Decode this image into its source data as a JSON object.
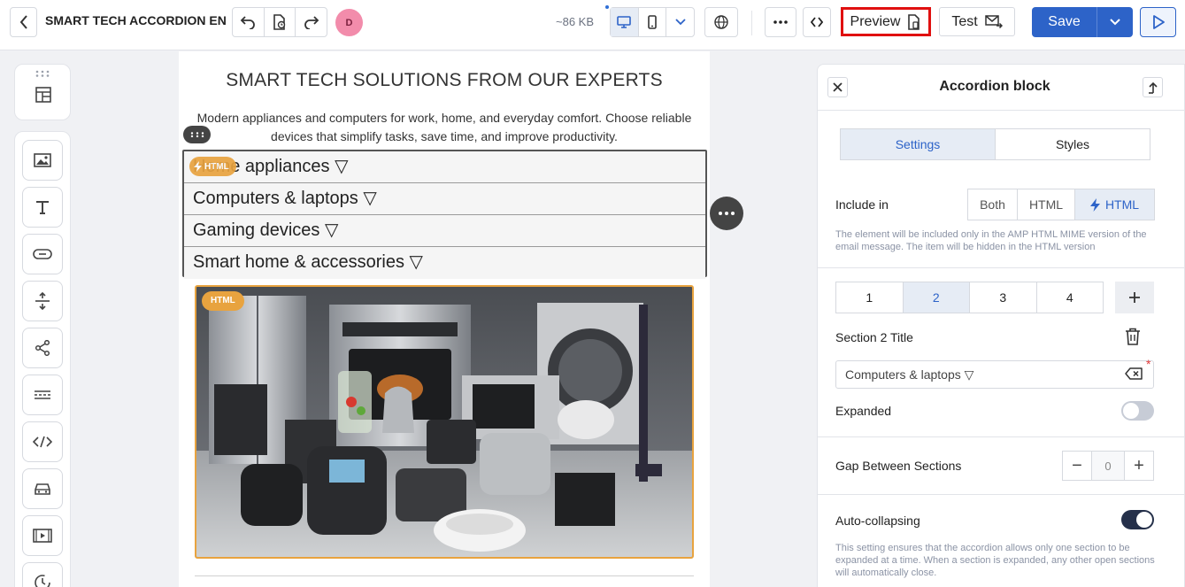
{
  "topbar": {
    "doc_title": "SMART TECH ACCORDION EN",
    "avatar_initial": "D",
    "size": "~86 KB",
    "preview_label": "Preview",
    "test_label": "Test",
    "save_label": "Save",
    "icons": [
      "back-icon",
      "undo-icon",
      "history-icon",
      "redo-icon",
      "desktop-icon",
      "mobile-icon",
      "chevron-down-icon",
      "globe-icon",
      "more-icon",
      "code-icon",
      "preview-device-icon",
      "mail-send-icon",
      "play-icon"
    ]
  },
  "left_toolbar": {
    "tools": [
      "structure",
      "image",
      "text",
      "button",
      "spacer",
      "social",
      "divider",
      "html",
      "menu",
      "video",
      "timer"
    ]
  },
  "canvas": {
    "title": "SMART TECH SOLUTIONS FROM OUR EXPERTS",
    "description": "Modern appliances and computers for work, home, and everyday comfort. Choose reliable devices that simplify tasks, save time, and improve productivity.",
    "amp_badge": "HTML",
    "accordion": [
      {
        "label": "Home appliances ▽"
      },
      {
        "label": "Computers & laptops ▽"
      },
      {
        "label": "Gaming devices ▽"
      },
      {
        "label": "Smart home & accessories ▽"
      }
    ],
    "image_badge": "HTML"
  },
  "panel": {
    "title": "Accordion block",
    "tabs": {
      "settings": "Settings",
      "styles": "Styles"
    },
    "include_in_label": "Include in",
    "include_options": {
      "both": "Both",
      "html": "HTML",
      "amp": "HTML"
    },
    "include_hint": "The element will be included only in the AMP HTML MIME version of the email message. The item will be hidden in the HTML version",
    "sections": [
      "1",
      "2",
      "3",
      "4"
    ],
    "active_section": "2",
    "section_title_label": "Section 2 Title",
    "section_title_value": "Computers & laptops ▽",
    "required_mark": "*",
    "expanded_label": "Expanded",
    "expanded": false,
    "gap_label": "Gap Between Sections",
    "gap_value": "0",
    "stepper_minus": "−",
    "stepper_plus": "+",
    "autocollapse_label": "Auto-collapsing",
    "autocollapse": true,
    "autocollapse_hint": "This setting ensures that the accordion allows only one section to be expanded at a time. When a section is expanded, any other open sections will automatically close."
  },
  "colors": {
    "accent": "#2d63c8",
    "amp_badge": "#e8a33f",
    "preview_highlight": "#e01010"
  }
}
